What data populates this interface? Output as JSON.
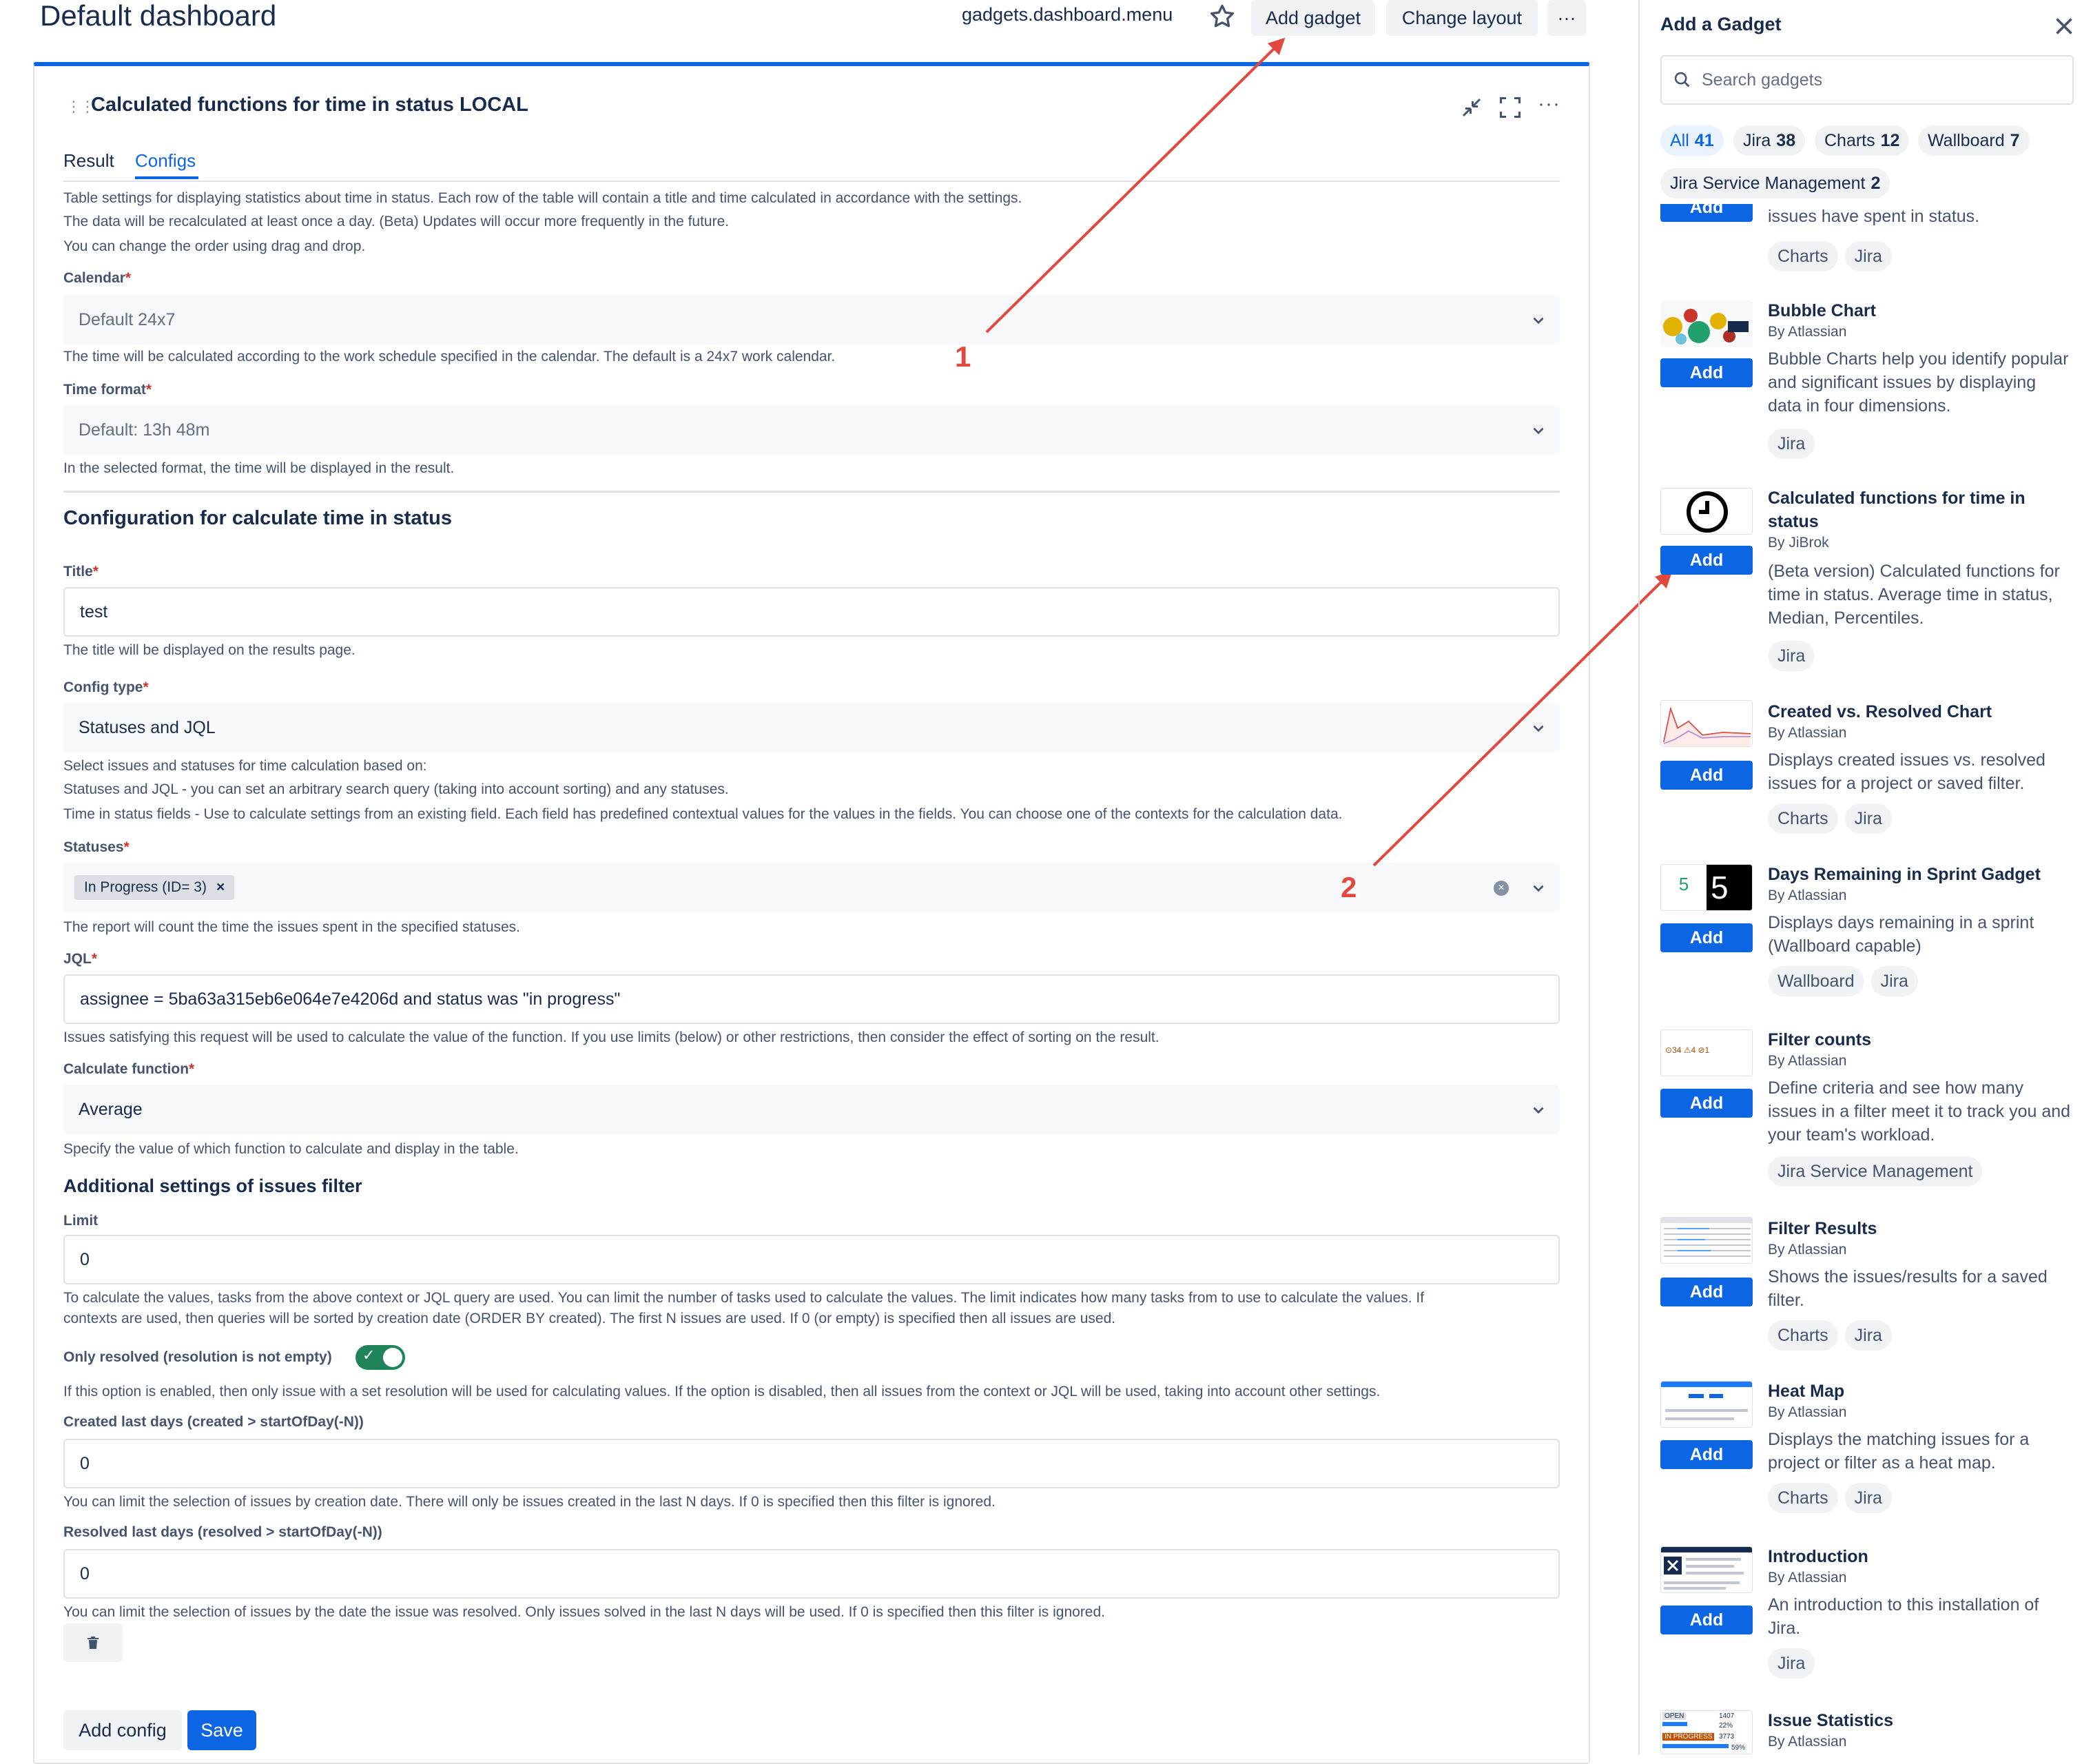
{
  "header": {
    "title": "Default dashboard",
    "menu_label": "gadgets.dashboard.menu",
    "add_gadget_label": "Add gadget",
    "change_layout_label": "Change layout",
    "more_label": "···"
  },
  "gadget": {
    "title": "Calculated functions for time in status LOCAL",
    "tabs": [
      "Result",
      "Configs"
    ],
    "active_tab": "Configs",
    "intro": [
      "Table settings for displaying statistics about time in status. Each row of the table will contain a title and time calculated in accordance with the settings.",
      "The data will be recalculated at least once a day. (Beta) Updates will occur more frequently in the future.",
      "You can change the order using drag and drop."
    ],
    "calendar": {
      "label": "Calendar",
      "value": "Default 24x7",
      "help": "The time will be calculated according to the work schedule specified in the calendar. The default is a 24x7 work calendar."
    },
    "time_format": {
      "label": "Time format",
      "value": "Default: 13h 48m",
      "help": "In the selected format, the time will be displayed in the result."
    },
    "config_section_title": "Configuration for calculate time in status",
    "title_field": {
      "label": "Title",
      "value": "test",
      "help": "The title will be displayed on the results page."
    },
    "config_type": {
      "label": "Config type",
      "value": "Statuses and JQL",
      "help": [
        "Select issues and statuses for time calculation based on:",
        "Statuses and JQL - you can set an arbitrary search query (taking into account sorting) and any statuses.",
        "Time in status fields - Use to calculate settings from an existing field. Each field has predefined contextual values for the values in the fields. You can choose one of the contexts for the calculation data."
      ]
    },
    "statuses": {
      "label": "Statuses",
      "tag": "In Progress (ID= 3)",
      "tag_remove": "×",
      "help": "The report will count the time the issues spent in the specified statuses."
    },
    "jql": {
      "label": "JQL",
      "value": "assignee = 5ba63a315eb6e064e7e4206d and status was \"in progress\"",
      "help": "Issues satisfying this request will be used to calculate the value of the function. If you use limits (below) or other restrictions, then consider the effect of sorting on the result."
    },
    "calc_function": {
      "label": "Calculate function",
      "value": "Average",
      "help": "Specify the value of which function to calculate and display in the table."
    },
    "additional_title": "Additional settings of issues filter",
    "limit": {
      "label": "Limit",
      "value": "0",
      "help": [
        "To calculate the values, tasks from the above context or JQL query are used. You can limit the number of tasks used to calculate the values. The limit indicates how many tasks from to use to calculate the values. If",
        "contexts are used, then queries will be sorted by creation date (ORDER BY created). The first N issues are used. If 0 (or empty) is specified then all issues are used."
      ]
    },
    "only_resolved": {
      "label": "Only resolved (resolution is not empty)",
      "on": true,
      "help": "If this option is enabled, then only issue with a set resolution will be used for calculating values. If the option is disabled, then all issues from the context or JQL will be used, taking into account other settings."
    },
    "created_last_days": {
      "label": "Created last days (created > startOfDay(-N))",
      "value": "0",
      "help": "You can limit the selection of issues by creation date. There will only be issues created in the last N days. If 0 is specified then this filter is ignored."
    },
    "resolved_last_days": {
      "label": "Resolved last days (resolved > startOfDay(-N))",
      "value": "0",
      "help": "You can limit the selection of issues by the date the issue was resolved. Only issues solved in the last N days will be used. If 0 is specified then this filter is ignored."
    },
    "add_config_label": "Add config",
    "save_label": "Save",
    "required_mark": "*"
  },
  "annotations": {
    "one": "1",
    "two": "2",
    "arrow_color": "#e2483d"
  },
  "panel": {
    "title": "Add a Gadget",
    "search_placeholder": "Search gadgets",
    "filters": [
      {
        "label": "All",
        "count": "41"
      },
      {
        "label": "Jira",
        "count": "38"
      },
      {
        "label": "Charts",
        "count": "12"
      },
      {
        "label": "Wallboard",
        "count": "7"
      },
      {
        "label": "Jira Service Management",
        "count": "2"
      }
    ],
    "add_label": "Add",
    "partial_item": {
      "desc": "issues have spent in status.",
      "tags": [
        "Charts",
        "Jira"
      ]
    },
    "gadgets": [
      {
        "name": "Bubble Chart",
        "by": "By Atlassian",
        "desc": "Bubble Charts help you identify popular and significant issues by displaying data in four dimensions.",
        "tags": [
          "Jira"
        ]
      },
      {
        "name": "Calculated functions for time in status",
        "by": "By JiBrok",
        "desc": "(Beta version) Calculated functions for time in status. Average time in status, Median, Percentiles.",
        "tags": [
          "Jira"
        ]
      },
      {
        "name": "Created vs. Resolved Chart",
        "by": "By Atlassian",
        "desc": "Displays created issues vs. resolved issues for a project or saved filter.",
        "tags": [
          "Charts",
          "Jira"
        ]
      },
      {
        "name": "Days Remaining in Sprint Gadget",
        "by": "By Atlassian",
        "desc": "Displays days remaining in a sprint (Wallboard capable)",
        "tags": [
          "Wallboard",
          "Jira"
        ]
      },
      {
        "name": "Filter counts",
        "by": "By Atlassian",
        "desc": "Define criteria and see how many issues in a filter meet it to track you and your team's workload.",
        "tags": [
          "Jira Service Management"
        ]
      },
      {
        "name": "Filter Results",
        "by": "By Atlassian",
        "desc": "Shows the issues/results for a saved filter.",
        "tags": [
          "Charts",
          "Jira"
        ]
      },
      {
        "name": "Heat Map",
        "by": "By Atlassian",
        "desc": "Displays the matching issues for a project or filter as a heat map.",
        "tags": [
          "Charts",
          "Jira"
        ]
      },
      {
        "name": "Introduction",
        "by": "By Atlassian",
        "desc": "An introduction to this installation of Jira.",
        "tags": [
          "Jira"
        ]
      },
      {
        "name": "Issue Statistics",
        "by": "By Atlassian",
        "desc": "",
        "tags": []
      }
    ],
    "thumb_texts": {
      "days_small": "5",
      "days_big": "5",
      "filter_counts": "⊙34  ⚠4  ⊘1",
      "issue_stats_open": "OPEN",
      "issue_stats_open_count": "1407",
      "issue_stats_open_pct": "22%",
      "issue_stats_prog": "IN PROGRESS",
      "issue_stats_prog_count": "3773",
      "issue_stats_prog_pct": "59%"
    }
  }
}
